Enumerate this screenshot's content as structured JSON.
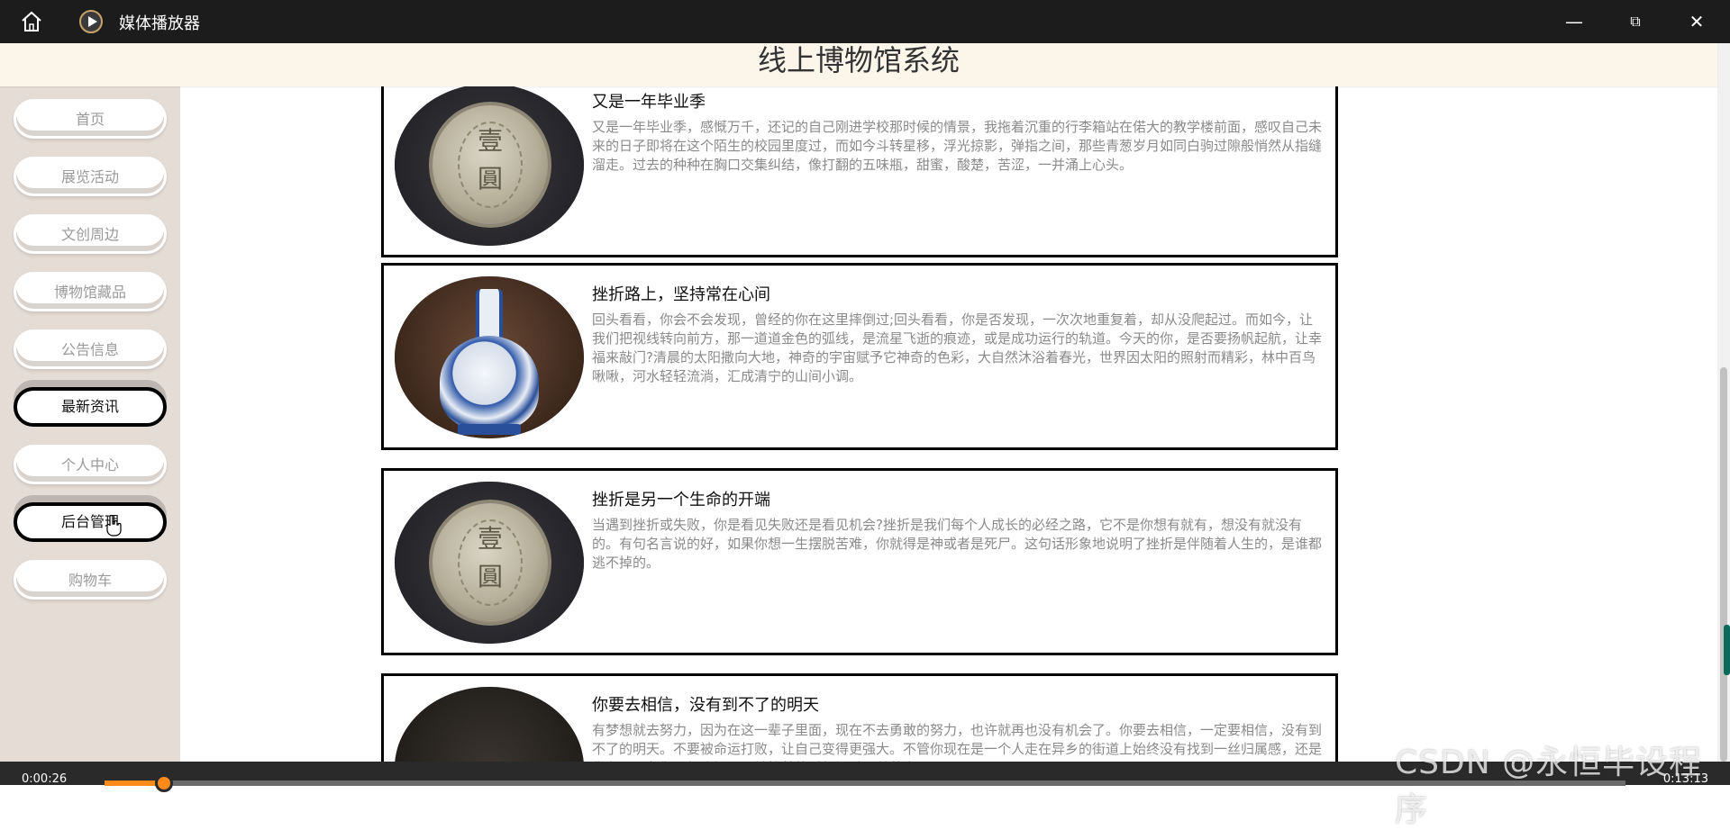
{
  "player": {
    "title": "媒体播放器",
    "time_elapsed": "0:00:26",
    "time_total": "0:13:13",
    "progress_fraction": 0.033
  },
  "site": {
    "title": "线上博物馆系统"
  },
  "sidebar": {
    "items": [
      {
        "label": "首页",
        "active": false
      },
      {
        "label": "展览活动",
        "active": false
      },
      {
        "label": "文创周边",
        "active": false
      },
      {
        "label": "博物馆藏品",
        "active": false
      },
      {
        "label": "公告信息",
        "active": false
      },
      {
        "label": "最新资讯",
        "active": true
      },
      {
        "label": "个人中心",
        "active": false
      },
      {
        "label": "后台管理",
        "active": true
      },
      {
        "label": "购物车",
        "active": false
      }
    ]
  },
  "news": [
    {
      "title": "又是一年毕业季",
      "image": "silver-coin",
      "text": "又是一年毕业季，感慨万千，还记的自己刚进学校那时候的情景，我拖着沉重的行李箱站在偌大的教学楼前面，感叹自己未来的日子即将在这个陌生的校园里度过，而如今斗转星移，浮光掠影，弹指之间，那些青葱岁月如同白驹过隙般悄然从指缝溜走。过去的种种在胸口交集纠结，像打翻的五味瓶，甜蜜，酸楚，苦涩，一并涌上心头。"
    },
    {
      "title": "挫折路上，坚持常在心间",
      "image": "blue-white-vase",
      "text": "回头看看，你会不会发现，曾经的你在这里摔倒过;回头看看，你是否发现，一次次地重复着，却从没爬起过。而如今，让我们把视线转向前方，那一道道金色的弧线，是流星飞逝的痕迹，或是成功运行的轨道。今天的你，是否要扬帆起航，让幸福来敲门?清晨的太阳撒向大地，神奇的宇宙赋予它神奇的色彩，大自然沐浴着春光，世界因太阳的照射而精彩，林中百鸟啾啾，河水轻轻流淌，汇成清宁的山间小调。"
    },
    {
      "title": "挫折是另一个生命的开端",
      "image": "silver-coin",
      "text": "当遇到挫折或失败，你是看见失败还是看见机会?挫折是我们每个人成长的必经之路，它不是你想有就有，想没有就没有的。有句名言说的好，如果你想一生摆脱苦难，你就得是神或者是死尸。这句话形象地说明了挫折是伴随着人生的，是谁都逃不掉的。"
    },
    {
      "title": "你要去相信，没有到不了的明天",
      "image": "bronze-pot",
      "text": "有梦想就去努力，因为在这一辈子里面，现在不去勇敢的努力，也许就再也没有机会了。你要去相信，一定要相信，没有到不了的明天。不要被命运打败，让自己变得更强大。不管你现在是一个人走在异乡的街道上始终没有找到一丝归属感，还是你在跟朋友们一起吃饭开心址笑着的时候闪过一丝落寞。"
    }
  ],
  "coin_chars": {
    "top": "壹",
    "bottom": "圓"
  },
  "watermark": "CSDN @永恒毕设程序",
  "colors": {
    "titlebar": "#1c1c1c",
    "header": "#fcf5ea",
    "sidebar": "#e6dcd6",
    "progress": "#ff8a1a"
  }
}
